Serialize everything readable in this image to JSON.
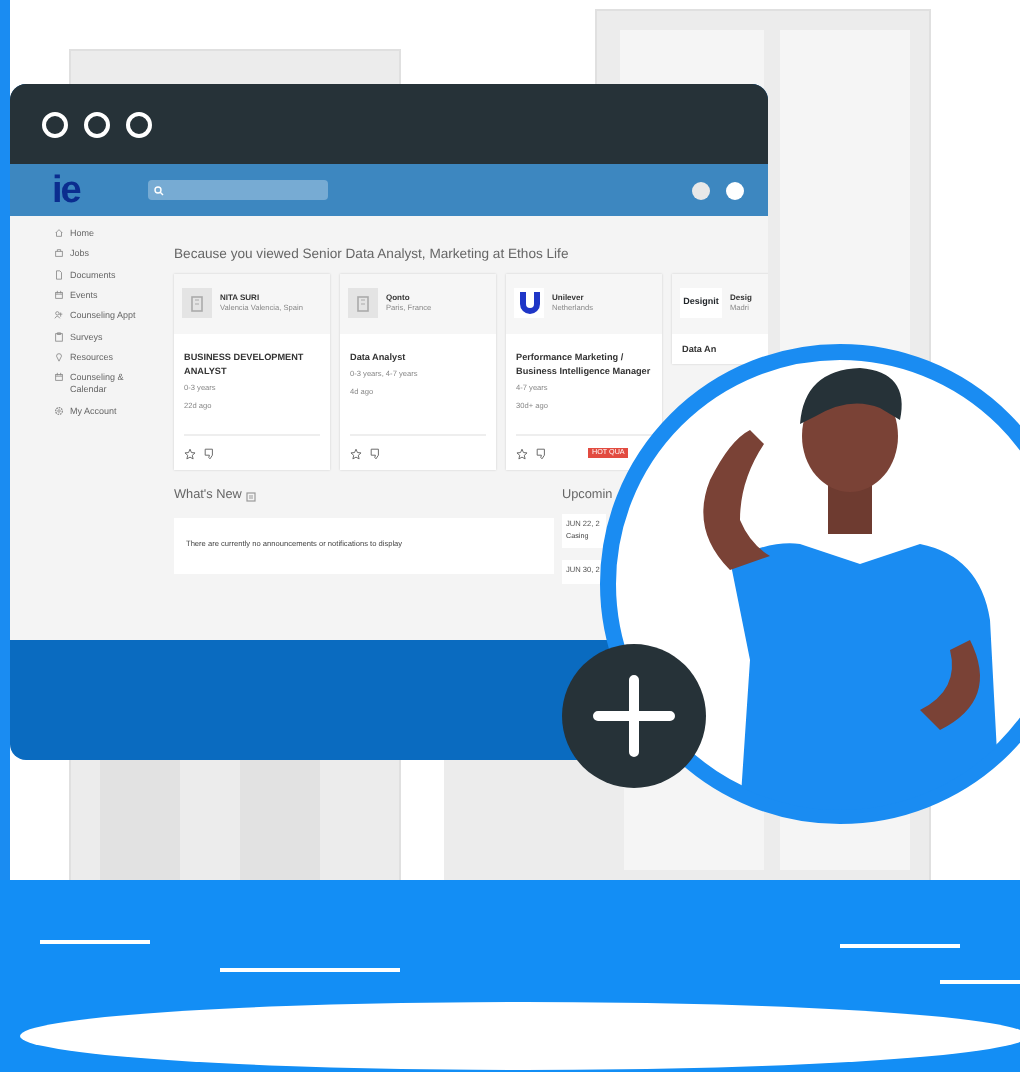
{
  "page": {
    "logo": "ie",
    "sidebar": [
      {
        "label": "Home"
      },
      {
        "label": "Jobs"
      },
      {
        "label": "Documents"
      },
      {
        "label": "Events"
      },
      {
        "label": "Counseling Appt"
      },
      {
        "label": "Surveys"
      },
      {
        "label": "Resources"
      },
      {
        "label": "Counseling & Calendar"
      },
      {
        "label": "My Account"
      }
    ],
    "section_title": "Because you viewed Senior Data Analyst, Marketing at Ethos Life",
    "cards": [
      {
        "kind": "placeholder",
        "company": "NITA SURI",
        "location": "Valencia Valencia, Spain",
        "title": "BUSINESS DEVELOPMENT ANALYST",
        "experience": "0-3 years",
        "posted": "22d ago"
      },
      {
        "kind": "placeholder",
        "company": "Qonto",
        "location": "Paris, France",
        "title": "Data Analyst",
        "experience": "0-3 years, 4-7 years",
        "posted": "4d ago"
      },
      {
        "kind": "u-mark",
        "company": "Unilever",
        "location": "Netherlands",
        "title": "Performance Marketing / Business Intelligence Manager",
        "experience": "4-7 years",
        "posted": "30d+ ago",
        "badge": "HOT QUA"
      },
      {
        "kind": "wordmark",
        "logo_text": "Designit",
        "company": "Desig",
        "location": "Madri",
        "title": "Data An"
      }
    ],
    "whats_new": {
      "title": "What's New",
      "message": "There are currently no announcements or notifications to display"
    },
    "upcoming": {
      "title": "Upcomin",
      "events": [
        {
          "date": "JUN 22, 2",
          "title": "Casing"
        },
        {
          "date": "JUN 30, 2"
        }
      ]
    }
  }
}
